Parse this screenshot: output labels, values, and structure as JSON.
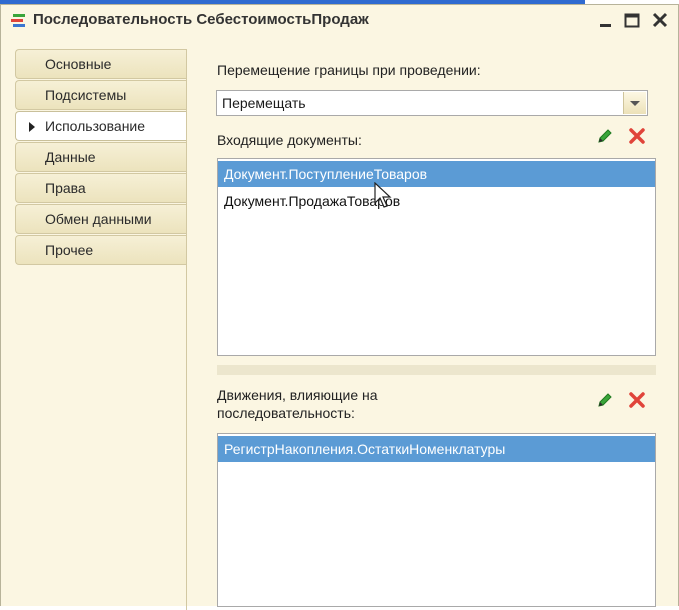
{
  "window": {
    "title": "Последовательность СебестоимостьПродаж"
  },
  "sidebar": {
    "items": [
      {
        "label": "Основные",
        "active": false
      },
      {
        "label": "Подсистемы",
        "active": false
      },
      {
        "label": "Использование",
        "active": true
      },
      {
        "label": "Данные",
        "active": false
      },
      {
        "label": "Права",
        "active": false
      },
      {
        "label": "Обмен данными",
        "active": false
      },
      {
        "label": "Прочее",
        "active": false
      }
    ]
  },
  "main": {
    "boundary_label": "Перемещение границы при проведении:",
    "boundary_value": "Перемещать",
    "incoming_label": "Входящие документы:",
    "incoming_docs": [
      {
        "text": "Документ.ПоступлениеТоваров",
        "selected": true
      },
      {
        "text": "Документ.ПродажаТоваров",
        "selected": false
      }
    ],
    "movements_label_line1": "Движения, влияющие на",
    "movements_label_line2": "последовательность:",
    "movements": [
      {
        "text": "РегистрНакопления.ОстаткиНоменклатуры",
        "selected": true
      }
    ]
  },
  "colors": {
    "window_bg": "#fbf6e2",
    "selection": "#5b9bd5",
    "edit_icon": "#3aa53a",
    "delete_icon": "#e0443a"
  }
}
